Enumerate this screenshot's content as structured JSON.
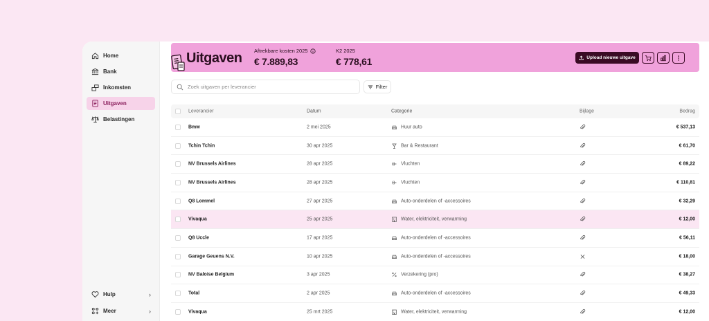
{
  "sidebar": {
    "items": [
      {
        "label": "Home",
        "icon": "home-icon"
      },
      {
        "label": "Bank",
        "icon": "bank-icon"
      },
      {
        "label": "Inkomsten",
        "icon": "income-icon"
      },
      {
        "label": "Uitgaven",
        "icon": "expenses-icon",
        "active": true
      },
      {
        "label": "Belastingen",
        "icon": "scale-icon"
      }
    ],
    "bottom": [
      {
        "label": "Hulp",
        "icon": "heart-icon"
      },
      {
        "label": "Meer",
        "icon": "more-icon"
      }
    ]
  },
  "header": {
    "title": "Uitgaven",
    "stats": [
      {
        "label": "Aftrekbare kosten 2025",
        "value": "€ 7.889,83"
      },
      {
        "label": "K2 2025",
        "value": "€ 778,61"
      }
    ],
    "upload_label": "Upload nieuwe uitgave",
    "accent": "#f0a2db",
    "dark": "#3a0a24"
  },
  "search": {
    "placeholder": "Zoek uitgaven per leverancier"
  },
  "filter_label": "Filter",
  "table": {
    "columns": [
      "Leverancier",
      "Datum",
      "Categorie",
      "Bijlage",
      "Bedrag"
    ],
    "rows": [
      {
        "supplier": "Bmw",
        "date": "2 mei 2025",
        "category": "Huur auto",
        "cat_icon": "car",
        "attachment": "paperclip",
        "amount": "€ 537,13"
      },
      {
        "supplier": "Tchin Tchin",
        "date": "30 apr 2025",
        "category": "Bar & Restaurant",
        "cat_icon": "glass",
        "attachment": "paperclip",
        "amount": "€ 61,70"
      },
      {
        "supplier": "NV Brussels Airlines",
        "date": "28 apr 2025",
        "category": "Vluchten",
        "cat_icon": "plane",
        "attachment": "paperclip",
        "amount": "€ 89,22"
      },
      {
        "supplier": "NV Brussels Airlines",
        "date": "28 apr 2025",
        "category": "Vluchten",
        "cat_icon": "plane",
        "attachment": "paperclip",
        "amount": "€ 110,81"
      },
      {
        "supplier": "Q8 Lommel",
        "date": "27 apr 2025",
        "category": "Auto-onderdelen of -accessoires",
        "cat_icon": "car",
        "attachment": "paperclip",
        "amount": "€ 32,29"
      },
      {
        "supplier": "Vivaqua",
        "date": "25 apr 2025",
        "category": "Water, elektriciteit, verwarming",
        "cat_icon": "building",
        "attachment": "paperclip",
        "amount": "€ 12,00",
        "highlight": true
      },
      {
        "supplier": "Q8 Uccle",
        "date": "17 apr 2025",
        "category": "Auto-onderdelen of -accessoires",
        "cat_icon": "car",
        "attachment": "paperclip",
        "amount": "€ 56,11"
      },
      {
        "supplier": "Garage Geuens N.V.",
        "date": "10 apr 2025",
        "category": "Auto-onderdelen of -accessoires",
        "cat_icon": "car",
        "attachment": "none",
        "amount": "€ 18,00"
      },
      {
        "supplier": "NV Baloise Belgium",
        "date": "3 apr 2025",
        "category": "Verzekering (pro)",
        "cat_icon": "percent",
        "attachment": "paperclip",
        "amount": "€ 38,27"
      },
      {
        "supplier": "Total",
        "date": "2 apr 2025",
        "category": "Auto-onderdelen of -accessoires",
        "cat_icon": "car",
        "attachment": "paperclip",
        "amount": "€ 49,33"
      },
      {
        "supplier": "Vivaqua",
        "date": "25 mrt 2025",
        "category": "Water, elektriciteit, verwarming",
        "cat_icon": "building",
        "attachment": "paperclip",
        "amount": "€ 12,00"
      }
    ]
  }
}
